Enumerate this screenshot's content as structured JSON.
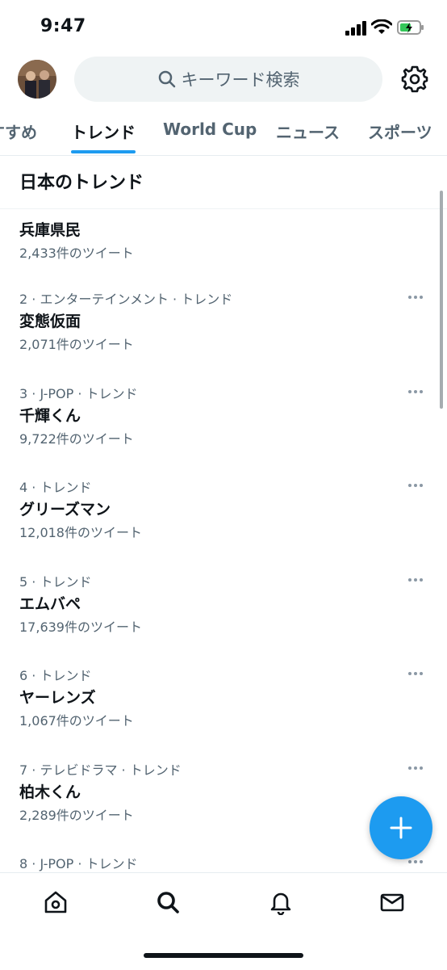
{
  "status_bar": {
    "time": "9:47"
  },
  "search": {
    "placeholder": "キーワード検索"
  },
  "tabs": [
    {
      "label": "すすめ"
    },
    {
      "label": "トレンド"
    },
    {
      "label": "World Cup"
    },
    {
      "label": "ニュース"
    },
    {
      "label": "スポーツ"
    }
  ],
  "section": {
    "title": "日本のトレンド"
  },
  "trends": [
    {
      "meta": "",
      "name": "兵庫県民",
      "count": "2,433件のツイート"
    },
    {
      "meta": "2 · エンターテインメント · トレンド",
      "name": "変態仮面",
      "count": "2,071件のツイート"
    },
    {
      "meta": "3 · J-POP · トレンド",
      "name": "千輝くん",
      "count": "9,722件のツイート"
    },
    {
      "meta": "4 · トレンド",
      "name": "グリーズマン",
      "count": "12,018件のツイート"
    },
    {
      "meta": "5 · トレンド",
      "name": "エムバペ",
      "count": "17,639件のツイート"
    },
    {
      "meta": "6 · トレンド",
      "name": "ヤーレンズ",
      "count": "1,067件のツイート"
    },
    {
      "meta": "7 · テレビドラマ · トレンド",
      "name": "柏木くん",
      "count": "2,289件のツイート"
    },
    {
      "meta": "8 · J-POP · トレンド",
      "name": "",
      "count": ""
    }
  ],
  "icons": {
    "search": "search-icon",
    "settings": "gear-icon",
    "more": "more-icon",
    "compose": "plus-icon",
    "nav": [
      "home-icon",
      "search-icon",
      "bell-icon",
      "mail-icon"
    ]
  },
  "colors": {
    "accent": "#1d9bf0",
    "text": "#0f1419",
    "muted": "#536471"
  }
}
